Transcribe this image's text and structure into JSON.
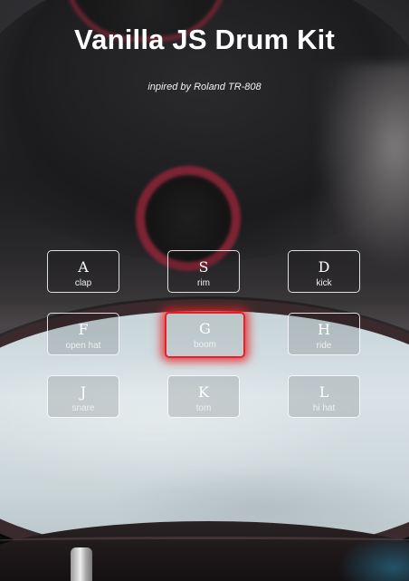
{
  "header": {
    "title": "Vanilla JS Drum Kit",
    "subtitle": "inpired by Roland TR-808"
  },
  "keys": [
    {
      "letter": "A",
      "sound": "clap"
    },
    {
      "letter": "S",
      "sound": "rim"
    },
    {
      "letter": "D",
      "sound": "kick"
    },
    {
      "letter": "F",
      "sound": "open hat"
    },
    {
      "letter": "G",
      "sound": "boom",
      "playing": true
    },
    {
      "letter": "H",
      "sound": "ride"
    },
    {
      "letter": "J",
      "sound": "snare"
    },
    {
      "letter": "K",
      "sound": "tom"
    },
    {
      "letter": "L",
      "sound": "hi hat"
    }
  ],
  "colors": {
    "accent_playing": "#e81f24",
    "text": "#ffffff"
  }
}
